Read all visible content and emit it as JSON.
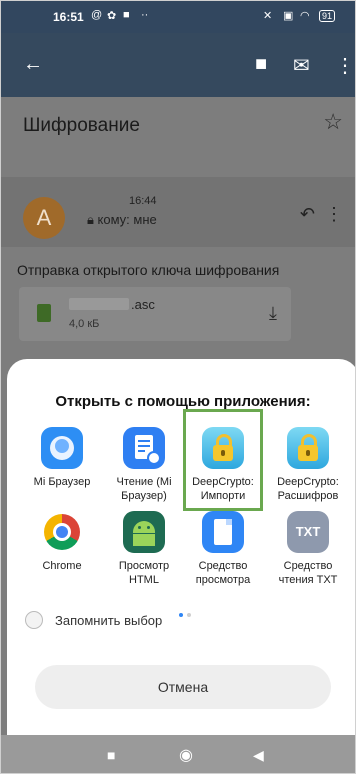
{
  "status": {
    "time": "16:51",
    "left_icons": [
      "at-icon",
      "gear-icon",
      "app-icon",
      "ellipsis-icon"
    ],
    "battery": "91"
  },
  "email": {
    "subject": "Шифрование",
    "sender_initial": "A",
    "time": "16:44",
    "to_text": "кому: мне",
    "body": "Отправка открытого ключа шифрования",
    "attachment": {
      "name": ".asc",
      "size": "4,0 кБ"
    }
  },
  "share_sheet": {
    "title": "Открыть с помощью приложения:",
    "apps": [
      {
        "label": "Mi Браузер",
        "icon": "mi-browser-icon"
      },
      {
        "label": "Чтение (Mi Браузер)",
        "icon": "reader-icon"
      },
      {
        "label": "DeepCrypto: Импорти",
        "icon": "deepcrypto-lock-icon",
        "highlighted": true
      },
      {
        "label": "DeepCrypto: Расшифров",
        "icon": "deepcrypto-lock-icon"
      },
      {
        "label": "Chrome",
        "icon": "chrome-icon"
      },
      {
        "label": "Просмотр HTML",
        "icon": "android-html-icon"
      },
      {
        "label": "Средство просмотра",
        "icon": "document-viewer-icon"
      },
      {
        "label": "Средство чтения TXT",
        "icon": "txt-reader-icon"
      }
    ],
    "txt_icon_text": "TXT",
    "remember_label": "Запомнить выбор",
    "cancel_label": "Отмена"
  },
  "colors": {
    "highlight": "#6aa84f",
    "accent": "#2f86f5"
  }
}
